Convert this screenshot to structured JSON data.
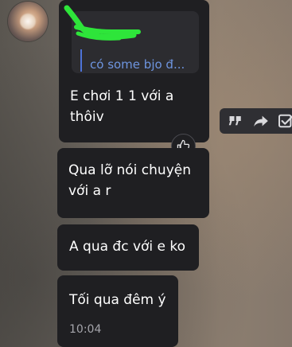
{
  "messages": [
    {
      "reply_preview": "có some bjo đ...",
      "text": "E chơi 1 1 với a thôiv"
    },
    {
      "text": "Qua lỡ nói chuyện với a r"
    },
    {
      "text": "A qua đc với e ko"
    },
    {
      "text": "Tối qua đêm ý",
      "time": "10:04"
    }
  ],
  "reaction_icon": "thumbs-up-icon",
  "actions": [
    {
      "icon": "quote-icon"
    },
    {
      "icon": "forward-icon"
    },
    {
      "icon": "check-square-icon"
    }
  ],
  "colors": {
    "bubble": "#1f1f22",
    "reply_bg": "#2c2c30",
    "reply_accent": "#4d73d8",
    "reply_text": "#6e95e0",
    "scribble": "#2ee53a",
    "action_bar": "#2f2f33"
  }
}
